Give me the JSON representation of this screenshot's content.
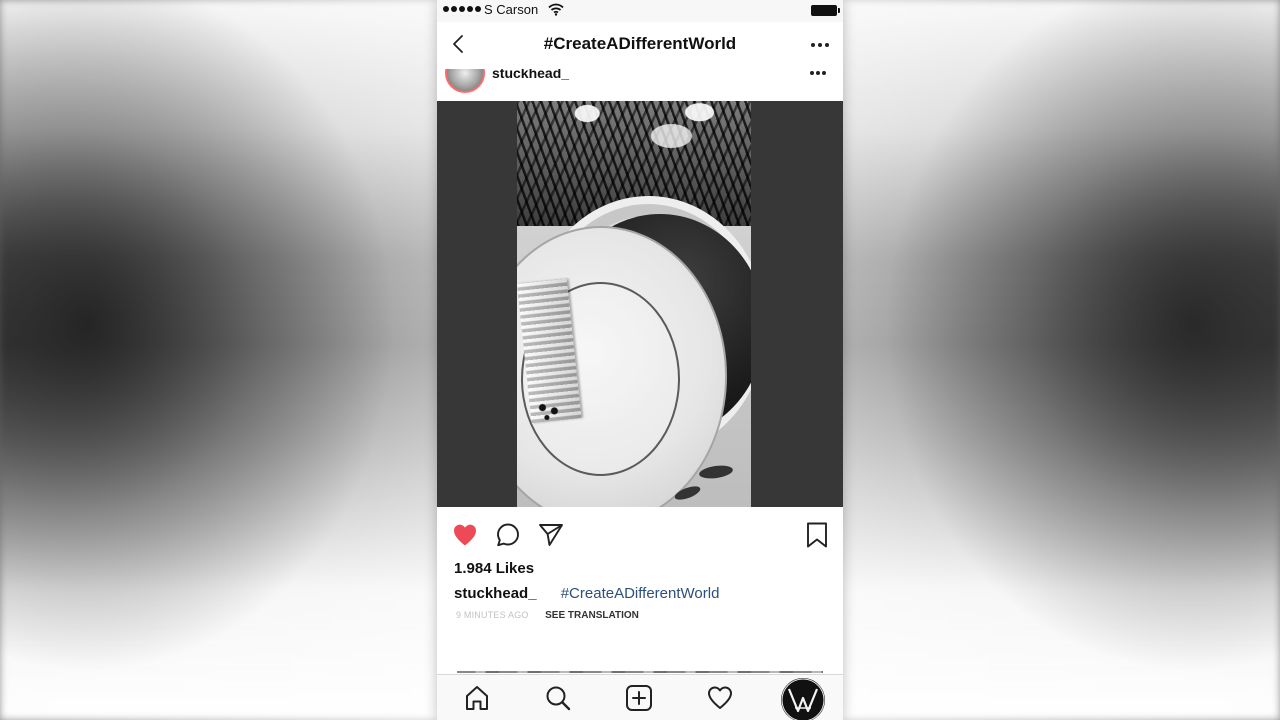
{
  "status_bar": {
    "carrier": "S Carson",
    "signal_strength": 5,
    "wifi_icon": "wifi-icon",
    "battery_icon": "battery-full-icon"
  },
  "nav": {
    "title": "#CreateADifferentWorld",
    "back_icon": "chevron-left-icon",
    "more_icon": "ellipsis-icon"
  },
  "post": {
    "username": "stuckhead_",
    "avatar_icon": "avatar",
    "more_icon": "ellipsis-icon",
    "media_type": "video",
    "likes_text": "1.984 Likes",
    "caption_user": "stuckhead_",
    "caption_hashtag": "#CreateADifferentWorld",
    "time_ago": "9 MINUTES AGO",
    "see_translation": "SEE TRANSLATION",
    "liked": true,
    "actions": [
      {
        "name": "like",
        "icon": "heart-filled-icon"
      },
      {
        "name": "comment",
        "icon": "comment-bubble-icon"
      },
      {
        "name": "share",
        "icon": "paper-plane-icon"
      },
      {
        "name": "bookmark",
        "icon": "bookmark-icon"
      }
    ]
  },
  "tab_bar": {
    "items": [
      {
        "name": "home",
        "icon": "home-icon"
      },
      {
        "name": "search",
        "icon": "search-icon"
      },
      {
        "name": "new-post",
        "icon": "plus-square-icon"
      },
      {
        "name": "activity",
        "icon": "heart-outline-icon"
      },
      {
        "name": "profile",
        "icon": "profile-logo-icon"
      }
    ]
  },
  "colors": {
    "like_red": "#ed4956",
    "hashtag_blue": "#2c4f7c",
    "text_dark": "#111111",
    "muted_gray": "#c2c2c2"
  }
}
